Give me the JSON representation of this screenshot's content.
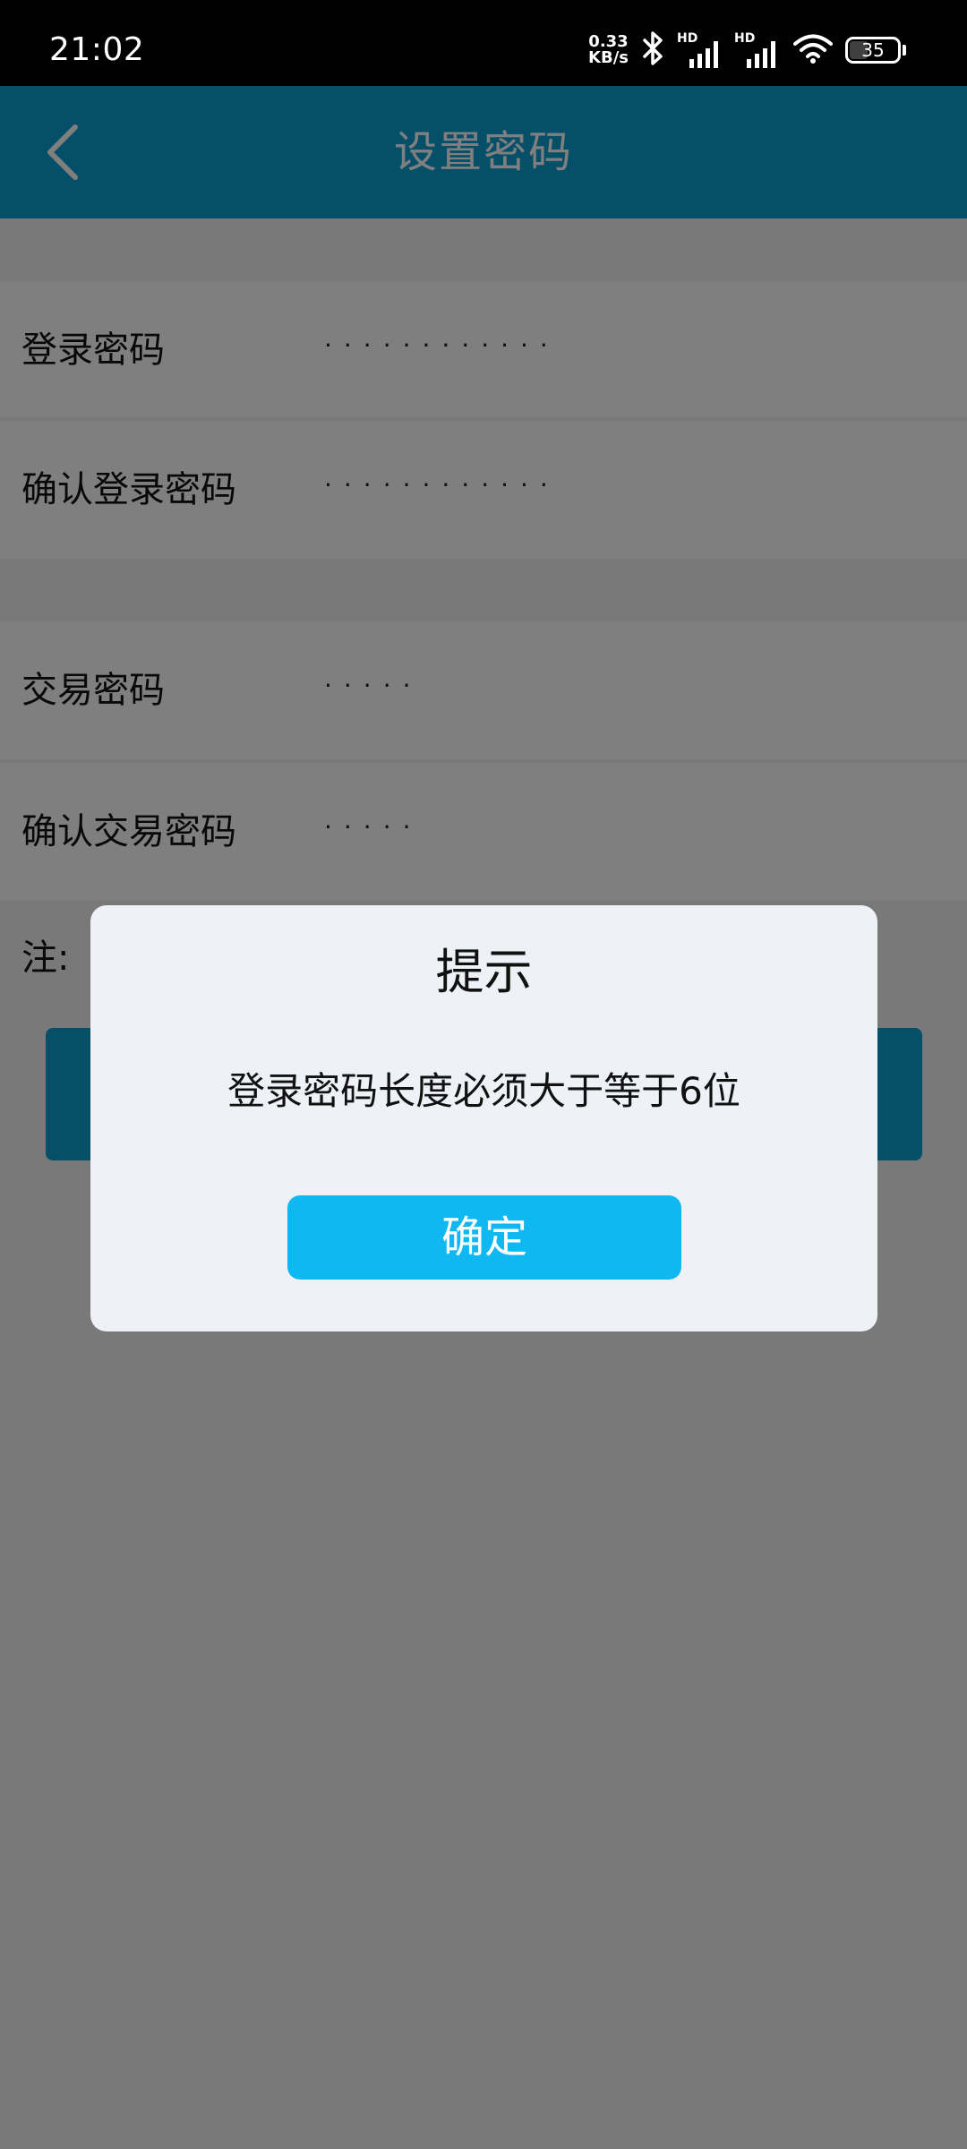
{
  "status_bar": {
    "time": "21:02",
    "net_speed_value": "0.33",
    "net_speed_unit": "KB/s",
    "signal_1_label": "HD",
    "signal_2_label": "HD",
    "battery_level": "35",
    "icons": [
      "bluetooth-icon",
      "signal-icon",
      "signal-icon",
      "wifi-icon",
      "battery-icon"
    ]
  },
  "header": {
    "title": "设置密码",
    "back_icon": "chevron-left-icon"
  },
  "form": {
    "login_password_label": "登录密码",
    "login_password_value": "············",
    "confirm_login_password_label": "确认登录密码",
    "confirm_login_password_value": "············",
    "trade_password_label": "交易密码",
    "trade_password_value": "·····",
    "confirm_trade_password_label": "确认交易密码",
    "confirm_trade_password_value": "·····",
    "note_label": "注:"
  },
  "dialog": {
    "title": "提示",
    "message": "登录密码长度必须大于等于6位",
    "confirm_label": "确定"
  },
  "colors": {
    "header_bg": "#0a9fd0",
    "confirm_button_bg": "#0fb8f0",
    "dialog_bg": "#eef1f5",
    "page_bg": "#f2f2f2"
  }
}
